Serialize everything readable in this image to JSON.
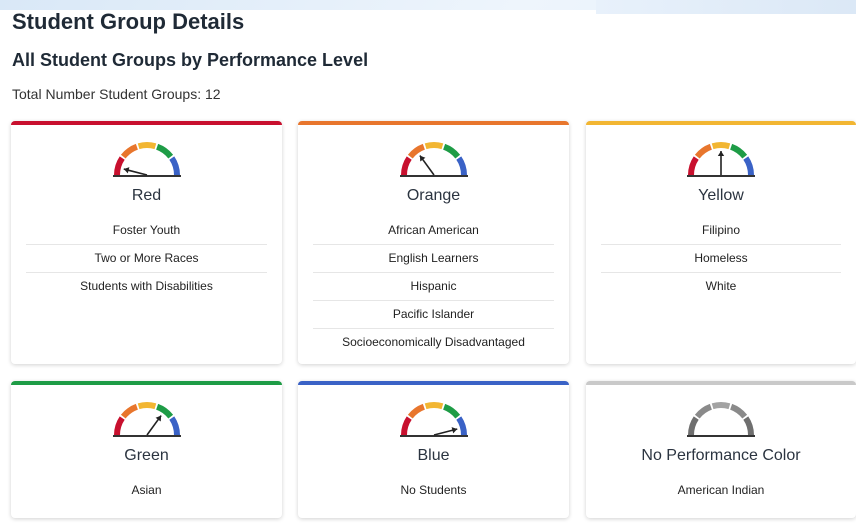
{
  "header": {
    "title": "Student Group Details",
    "subtitle": "All Student Groups by Performance Level",
    "total": "Total Number Student Groups: 12"
  },
  "colors": {
    "red": "#c8102e",
    "orange": "#e8762d",
    "yellow": "#f2b632",
    "green": "#1e9c46",
    "blue": "#3a62c6",
    "gray": "#c9c9c9"
  },
  "cards": [
    {
      "title": "Red",
      "accent": "#c8102e",
      "gauge_level": 0.08,
      "items": [
        "Foster Youth",
        "Two or More Races",
        "Students with Disabilities"
      ]
    },
    {
      "title": "Orange",
      "accent": "#e8762d",
      "gauge_level": 0.3,
      "items": [
        "African American",
        "English Learners",
        "Hispanic",
        "Pacific Islander",
        "Socioeconomically Disadvantaged"
      ]
    },
    {
      "title": "Yellow",
      "accent": "#f2b632",
      "gauge_level": 0.5,
      "items": [
        "Filipino",
        "Homeless",
        "White"
      ]
    },
    {
      "title": "Green",
      "accent": "#1e9c46",
      "gauge_level": 0.7,
      "items": [
        "Asian"
      ]
    },
    {
      "title": "Blue",
      "accent": "#3a62c6",
      "gauge_level": 0.92,
      "items": [
        "No Students"
      ]
    },
    {
      "title": "No Performance Color",
      "accent": "#c9c9c9",
      "gauge_level": null,
      "items": [
        "American Indian"
      ]
    }
  ]
}
